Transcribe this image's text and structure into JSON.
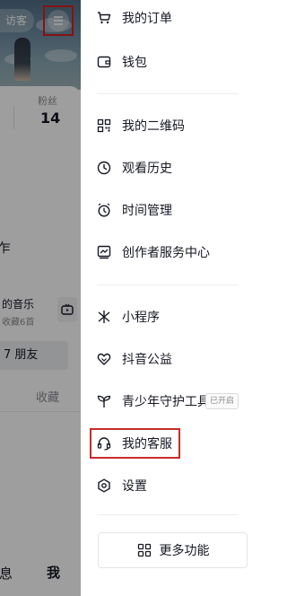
{
  "background_page": {
    "visitor_label": "访客",
    "fans_label": "粉丝",
    "fans_value": "14",
    "tail_text": "乍",
    "music_title": "的音乐",
    "music_subtitle": "收藏6首",
    "friend_text": "7 朋友",
    "collect_label": "收藏",
    "bottom_left_text": "息",
    "bottom_me_text": "我"
  },
  "drawer": {
    "items": [
      {
        "label": "我的订单",
        "icon": "cart-icon"
      },
      {
        "label": "钱包",
        "icon": "wallet-icon"
      },
      {
        "label": "我的二维码",
        "icon": "qrcode-icon"
      },
      {
        "label": "观看历史",
        "icon": "clock-icon"
      },
      {
        "label": "时间管理",
        "icon": "alarm-icon"
      },
      {
        "label": "创作者服务中心",
        "icon": "chart-icon"
      },
      {
        "label": "小程序",
        "icon": "miniprogram-icon"
      },
      {
        "label": "抖音公益",
        "icon": "heart-hand-icon"
      },
      {
        "label": "青少年守护工具",
        "icon": "sprout-icon",
        "badge": "已开启"
      },
      {
        "label": "我的客服",
        "icon": "headset-icon"
      },
      {
        "label": "设置",
        "icon": "settings-icon"
      }
    ],
    "more_button_label": "更多功能"
  },
  "colors": {
    "highlight": "#c92a2a",
    "text_primary": "#161823",
    "text_secondary": "#8a8b91"
  }
}
